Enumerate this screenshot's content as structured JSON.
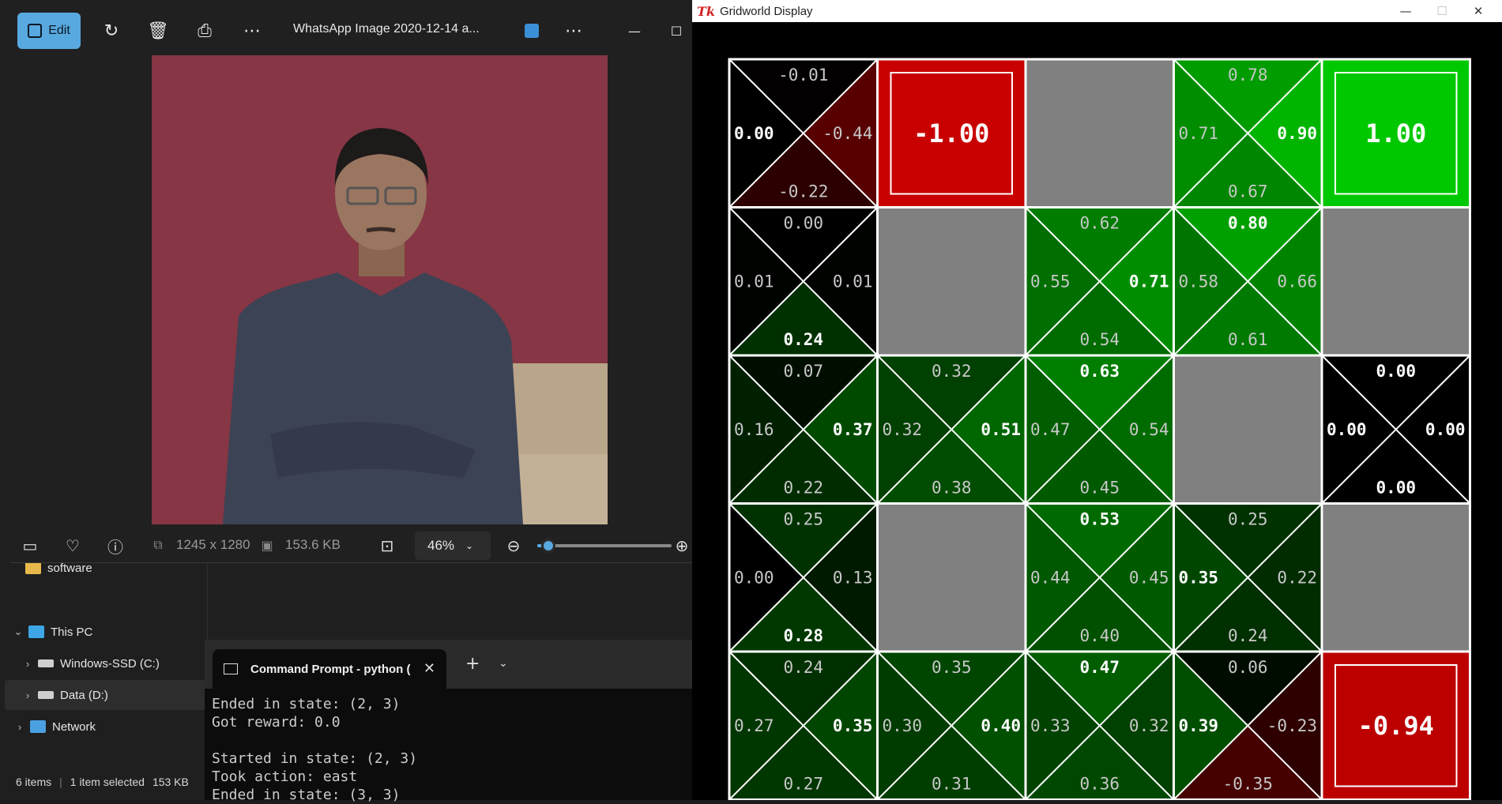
{
  "explorer": {
    "nav_items": [
      {
        "label": "software",
        "icon": "folder-icon"
      },
      {
        "label": "This PC",
        "icon": "computer-icon"
      },
      {
        "label": "Windows-SSD (C:)",
        "icon": "drive-icon"
      },
      {
        "label": "Data (D:)",
        "icon": "drive-icon"
      },
      {
        "label": "Network",
        "icon": "network-icon"
      }
    ],
    "status": {
      "items": "6 items",
      "selected": "1 item selected",
      "size": "153 KB"
    }
  },
  "photos": {
    "edit_label": "Edit",
    "title": "WhatsApp Image 2020-12-14 a...",
    "dimensions": "1245 x 1280",
    "file_size": "153.6 KB",
    "zoom": "46%",
    "zoom_level": 0.08
  },
  "cmd": {
    "tab_title": "Command Prompt - python (",
    "lines": [
      "Ended in state: (2, 3)",
      "Got reward: 0.0",
      "",
      "Started in state: (2, 3)",
      "Took action: east",
      "Ended in state: (3, 3)"
    ]
  },
  "gridworld": {
    "title": "Gridworld Display",
    "colors": {
      "positive": "#00c800",
      "negative": "#c80000",
      "wall": "#808080",
      "line": "#ffffff"
    },
    "cells": [
      [
        {
          "type": "q",
          "n": "-0.01",
          "e": "-0.44",
          "s": "-0.22",
          "w": "0.00",
          "best": "w"
        },
        {
          "type": "terminal",
          "value": "-1.00"
        },
        {
          "type": "wall"
        },
        {
          "type": "q",
          "n": "0.78",
          "e": "0.90",
          "s": "0.67",
          "w": "0.71",
          "best": "e"
        },
        {
          "type": "terminal",
          "value": "1.00"
        }
      ],
      [
        {
          "type": "q",
          "n": "0.00",
          "e": "0.01",
          "s": "0.24",
          "w": "0.01",
          "best": "s"
        },
        {
          "type": "wall"
        },
        {
          "type": "q",
          "n": "0.62",
          "e": "0.71",
          "s": "0.54",
          "w": "0.55",
          "best": "e"
        },
        {
          "type": "q",
          "n": "0.80",
          "e": "0.66",
          "s": "0.61",
          "w": "0.58",
          "best": "n"
        },
        {
          "type": "wall"
        }
      ],
      [
        {
          "type": "q",
          "n": "0.07",
          "e": "0.37",
          "s": "0.22",
          "w": "0.16",
          "best": "e"
        },
        {
          "type": "q",
          "n": "0.32",
          "e": "0.51",
          "s": "0.38",
          "w": "0.32",
          "best": "e"
        },
        {
          "type": "q",
          "n": "0.63",
          "e": "0.54",
          "s": "0.45",
          "w": "0.47",
          "best": "n"
        },
        {
          "type": "wall"
        },
        {
          "type": "q",
          "n": "0.00",
          "e": "0.00",
          "s": "0.00",
          "w": "0.00",
          "best": "all"
        }
      ],
      [
        {
          "type": "q",
          "n": "0.25",
          "e": "0.13",
          "s": "0.28",
          "w": "0.00",
          "best": "s"
        },
        {
          "type": "wall"
        },
        {
          "type": "q",
          "n": "0.53",
          "e": "0.45",
          "s": "0.40",
          "w": "0.44",
          "best": "n"
        },
        {
          "type": "q",
          "n": "0.25",
          "e": "0.22",
          "s": "0.24",
          "w": "0.35",
          "best": "w"
        },
        {
          "type": "wall"
        }
      ],
      [
        {
          "type": "q",
          "n": "0.24",
          "e": "0.35",
          "s": "0.27",
          "w": "0.27",
          "best": "e"
        },
        {
          "type": "q",
          "n": "0.35",
          "e": "0.40",
          "s": "0.31",
          "w": "0.30",
          "best": "e"
        },
        {
          "type": "q",
          "n": "0.47",
          "e": "0.32",
          "s": "0.36",
          "w": "0.33",
          "best": "n"
        },
        {
          "type": "q",
          "n": "0.06",
          "e": "-0.23",
          "s": "-0.35",
          "w": "0.39",
          "best": "w"
        },
        {
          "type": "terminal",
          "value": "-0.94"
        }
      ]
    ]
  }
}
